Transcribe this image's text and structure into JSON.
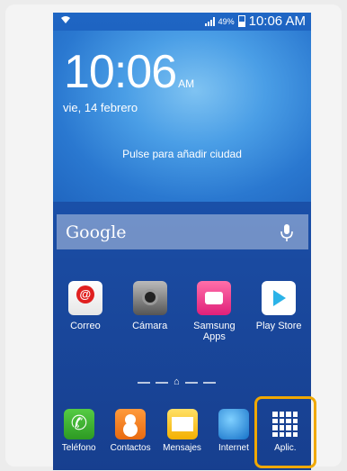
{
  "status_bar": {
    "battery_percent": "49%",
    "time": "10:06 AM",
    "icons": [
      "wifi-icon",
      "signal-icon",
      "battery-icon"
    ]
  },
  "widget": {
    "clock": "10:06",
    "ampm": "AM",
    "date": "vie, 14 febrero",
    "city_prompt": "Pulse para añadir ciudad"
  },
  "search": {
    "label": "Google",
    "mic_icon": "microphone-icon"
  },
  "apps": [
    {
      "label": "Correo",
      "icon": "correo-icon"
    },
    {
      "label": "Cámara",
      "icon": "camera-icon"
    },
    {
      "label": "Samsung Apps",
      "icon": "samsung-apps-icon"
    },
    {
      "label": "Play Store",
      "icon": "play-store-icon"
    }
  ],
  "dock": [
    {
      "label": "Teléfono",
      "icon": "phone-icon"
    },
    {
      "label": "Contactos",
      "icon": "contacts-icon"
    },
    {
      "label": "Mensajes",
      "icon": "messages-icon"
    },
    {
      "label": "Internet",
      "icon": "internet-icon"
    },
    {
      "label": "Aplic.",
      "icon": "apps-grid-icon"
    }
  ],
  "highlight_color": "#f0a800"
}
